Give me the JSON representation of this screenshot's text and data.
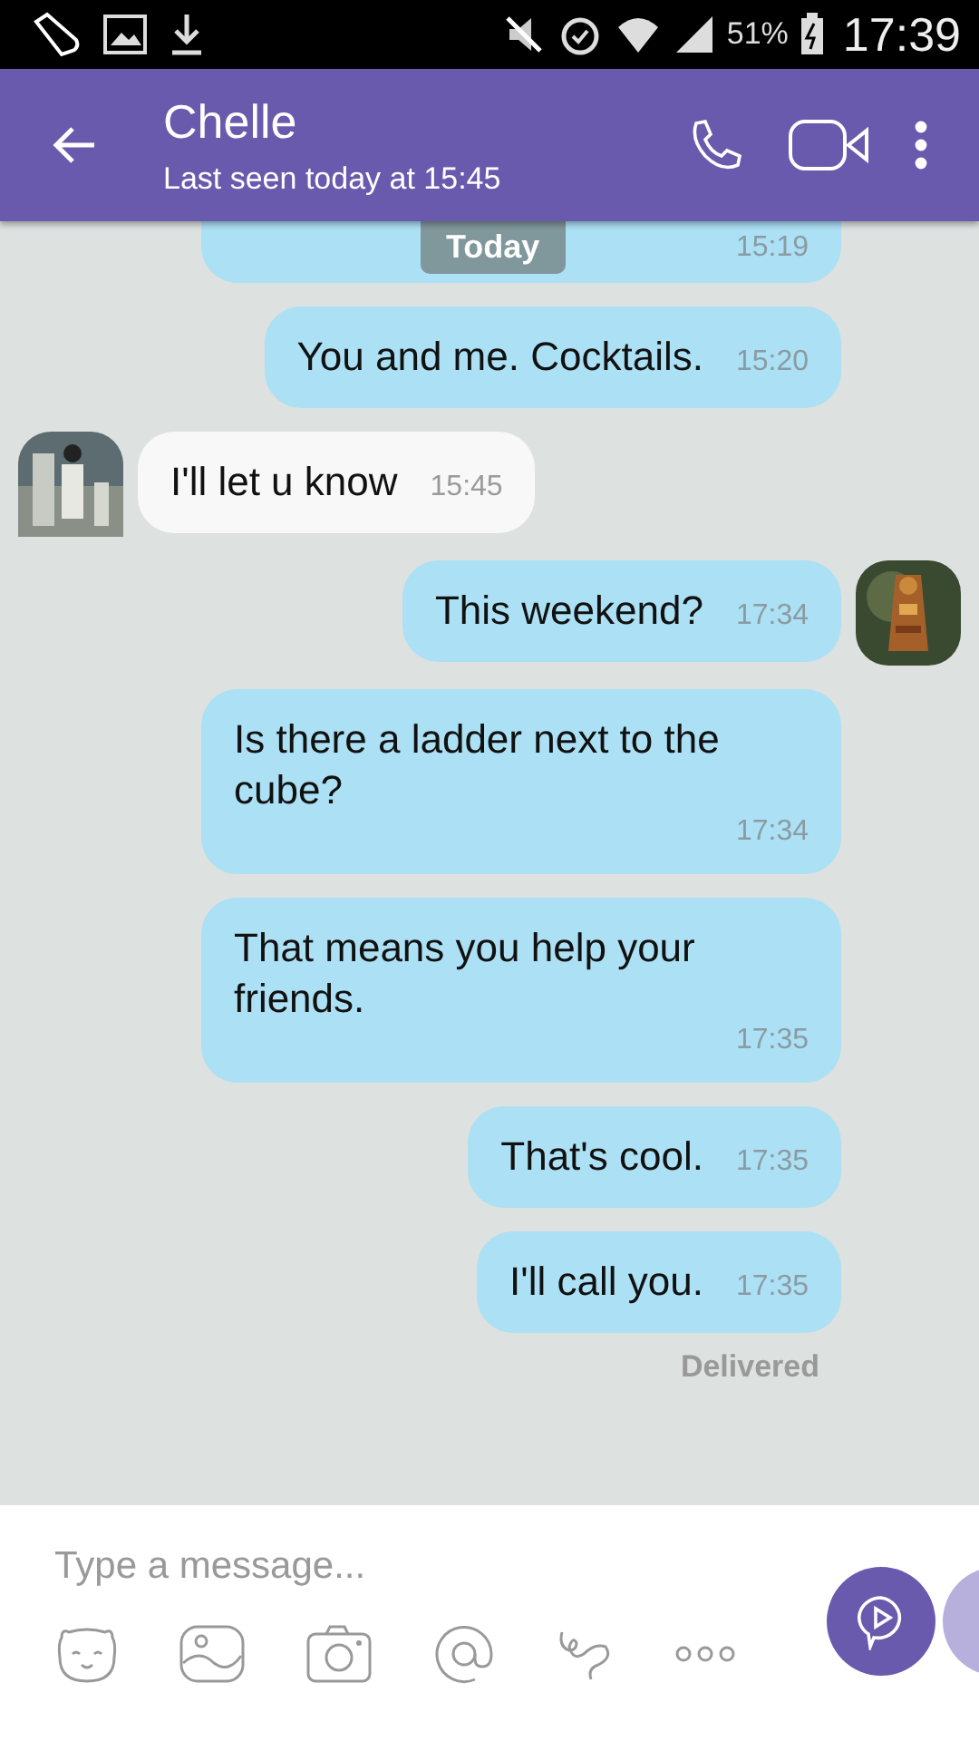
{
  "status_bar": {
    "battery": "51%",
    "time": "17:39"
  },
  "header": {
    "contact": "Chelle",
    "last_seen": "Last seen today at 15:45"
  },
  "date_chip": "Today",
  "messages": [
    {
      "kind": "outgoing",
      "time": "15:19",
      "avatar": false,
      "cut": true
    },
    {
      "kind": "outgoing",
      "text": "You and me.  Cocktails.",
      "time": "15:20",
      "avatar": false,
      "cut": false
    },
    {
      "kind": "incoming",
      "text": "I'll let u know",
      "time": "15:45",
      "avatar": true,
      "cut": false
    },
    {
      "kind": "outgoing",
      "text": "This weekend?",
      "time": "17:34",
      "avatar": true,
      "cut": false
    },
    {
      "kind": "outgoing",
      "text": "Is there a ladder next to the cube?",
      "time": "17:34",
      "avatar": false,
      "cut": false
    },
    {
      "kind": "outgoing",
      "text": "That means you help your friends.",
      "time": "17:35",
      "avatar": false,
      "cut": false
    },
    {
      "kind": "outgoing",
      "text": "That's cool.",
      "time": "17:35",
      "avatar": false,
      "cut": false
    },
    {
      "kind": "outgoing",
      "text": "I'll call you.",
      "time": "17:35",
      "avatar": false,
      "cut": false
    }
  ],
  "delivery_status": "Delivered",
  "composer": {
    "placeholder": "Type a message..."
  }
}
